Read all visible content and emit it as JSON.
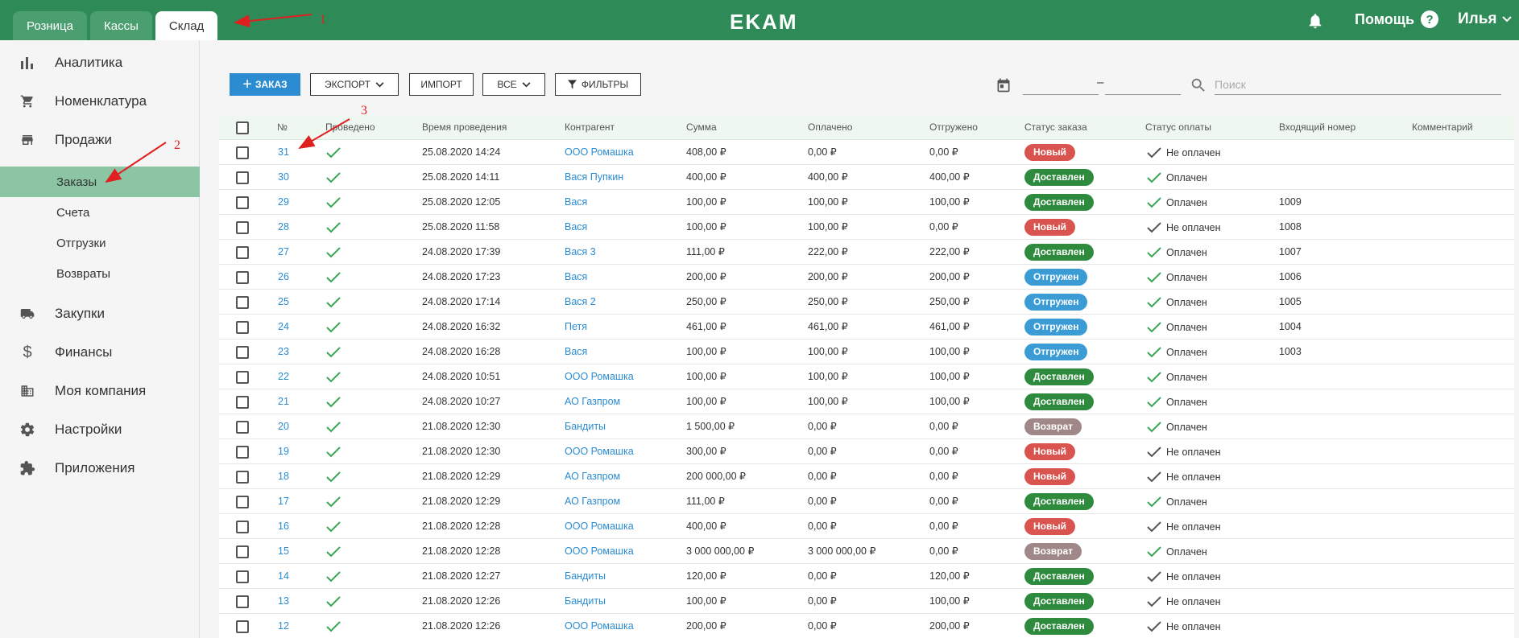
{
  "header": {
    "tabs": [
      {
        "label": "Розница"
      },
      {
        "label": "Кассы"
      },
      {
        "label": "Склад"
      }
    ],
    "active_tab": 2,
    "logo": "EKAM",
    "help_label": "Помощь",
    "help_glyph": "?",
    "user_name": "Илья",
    "icons": [
      "bell-icon",
      "help-icon",
      "chevron-down-icon"
    ]
  },
  "sidebar": {
    "items": [
      {
        "label": "Аналитика",
        "icon": "bar-chart-icon"
      },
      {
        "label": "Номенклатура",
        "icon": "cart-icon"
      },
      {
        "label": "Продажи",
        "icon": "store-icon"
      }
    ],
    "sub_items": [
      {
        "label": "Заказы",
        "active": true
      },
      {
        "label": "Счета"
      },
      {
        "label": "Отгрузки"
      },
      {
        "label": "Возвраты"
      }
    ],
    "items2": [
      {
        "label": "Закупки",
        "icon": "truck-icon"
      },
      {
        "label": "Финансы",
        "icon": "dollar-icon"
      },
      {
        "label": "Моя компания",
        "icon": "building-icon"
      },
      {
        "label": "Настройки",
        "icon": "gear-icon"
      },
      {
        "label": "Приложения",
        "icon": "puzzle-icon"
      }
    ]
  },
  "toolbar": {
    "add_label": "ЗАКАЗ",
    "add_glyph": "+",
    "export_label": "ЭКСПОРТ",
    "import_label": "ИМПОРТ",
    "all_label": "ВСЕ",
    "filters_label": "ФИЛЬТРЫ",
    "date_separator": "–",
    "search_placeholder": "Поиск"
  },
  "table": {
    "columns": [
      "№",
      "Проведено",
      "Время проведения",
      "Контрагент",
      "Сумма",
      "Оплачено",
      "Отгружено",
      "Статус заказа",
      "Статус оплаты",
      "Входящий номер",
      "Комментарий"
    ],
    "rows": [
      {
        "num": "31",
        "time": "25.08.2020 14:24",
        "party": "ООО Ромашка",
        "sum": "408,00 ₽",
        "paid": "0,00 ₽",
        "shipped": "0,00 ₽",
        "status": "Новый",
        "pay": "Не оплачен",
        "inc": ""
      },
      {
        "num": "30",
        "time": "25.08.2020 14:11",
        "party": "Вася Пупкин",
        "sum": "400,00 ₽",
        "paid": "400,00 ₽",
        "shipped": "400,00 ₽",
        "status": "Доставлен",
        "pay": "Оплачен",
        "inc": ""
      },
      {
        "num": "29",
        "time": "25.08.2020 12:05",
        "party": "Вася",
        "sum": "100,00 ₽",
        "paid": "100,00 ₽",
        "shipped": "100,00 ₽",
        "status": "Доставлен",
        "pay": "Оплачен",
        "inc": "1009"
      },
      {
        "num": "28",
        "time": "25.08.2020 11:58",
        "party": "Вася",
        "sum": "100,00 ₽",
        "paid": "100,00 ₽",
        "shipped": "0,00 ₽",
        "status": "Новый",
        "pay": "Не оплачен",
        "inc": "1008"
      },
      {
        "num": "27",
        "time": "24.08.2020 17:39",
        "party": "Вася 3",
        "sum": "111,00 ₽",
        "paid": "222,00 ₽",
        "shipped": "222,00 ₽",
        "status": "Доставлен",
        "pay": "Оплачен",
        "inc": "1007"
      },
      {
        "num": "26",
        "time": "24.08.2020 17:23",
        "party": "Вася",
        "sum": "200,00 ₽",
        "paid": "200,00 ₽",
        "shipped": "200,00 ₽",
        "status": "Отгружен",
        "pay": "Оплачен",
        "inc": "1006"
      },
      {
        "num": "25",
        "time": "24.08.2020 17:14",
        "party": "Вася 2",
        "sum": "250,00 ₽",
        "paid": "250,00 ₽",
        "shipped": "250,00 ₽",
        "status": "Отгружен",
        "pay": "Оплачен",
        "inc": "1005"
      },
      {
        "num": "24",
        "time": "24.08.2020 16:32",
        "party": "Петя",
        "sum": "461,00 ₽",
        "paid": "461,00 ₽",
        "shipped": "461,00 ₽",
        "status": "Отгружен",
        "pay": "Оплачен",
        "inc": "1004"
      },
      {
        "num": "23",
        "time": "24.08.2020 16:28",
        "party": "Вася",
        "sum": "100,00 ₽",
        "paid": "100,00 ₽",
        "shipped": "100,00 ₽",
        "status": "Отгружен",
        "pay": "Оплачен",
        "inc": "1003"
      },
      {
        "num": "22",
        "time": "24.08.2020 10:51",
        "party": "ООО Ромашка",
        "sum": "100,00 ₽",
        "paid": "100,00 ₽",
        "shipped": "100,00 ₽",
        "status": "Доставлен",
        "pay": "Оплачен",
        "inc": ""
      },
      {
        "num": "21",
        "time": "24.08.2020 10:27",
        "party": "АО Газпром",
        "sum": "100,00 ₽",
        "paid": "100,00 ₽",
        "shipped": "100,00 ₽",
        "status": "Доставлен",
        "pay": "Оплачен",
        "inc": ""
      },
      {
        "num": "20",
        "time": "21.08.2020 12:30",
        "party": "Бандиты",
        "sum": "1 500,00 ₽",
        "paid": "0,00 ₽",
        "shipped": "0,00 ₽",
        "status": "Возврат",
        "pay": "Оплачен",
        "inc": ""
      },
      {
        "num": "19",
        "time": "21.08.2020 12:30",
        "party": "ООО Ромашка",
        "sum": "300,00 ₽",
        "paid": "0,00 ₽",
        "shipped": "0,00 ₽",
        "status": "Новый",
        "pay": "Не оплачен",
        "inc": ""
      },
      {
        "num": "18",
        "time": "21.08.2020 12:29",
        "party": "АО Газпром",
        "sum": "200 000,00 ₽",
        "paid": "0,00 ₽",
        "shipped": "0,00 ₽",
        "status": "Новый",
        "pay": "Не оплачен",
        "inc": ""
      },
      {
        "num": "17",
        "time": "21.08.2020 12:29",
        "party": "АО Газпром",
        "sum": "111,00 ₽",
        "paid": "0,00 ₽",
        "shipped": "0,00 ₽",
        "status": "Доставлен",
        "pay": "Оплачен",
        "inc": ""
      },
      {
        "num": "16",
        "time": "21.08.2020 12:28",
        "party": "ООО Ромашка",
        "sum": "400,00 ₽",
        "paid": "0,00 ₽",
        "shipped": "0,00 ₽",
        "status": "Новый",
        "pay": "Не оплачен",
        "inc": ""
      },
      {
        "num": "15",
        "time": "21.08.2020 12:28",
        "party": "ООО Ромашка",
        "sum": "3 000 000,00 ₽",
        "paid": "3 000 000,00 ₽",
        "shipped": "0,00 ₽",
        "status": "Возврат",
        "pay": "Оплачен",
        "inc": ""
      },
      {
        "num": "14",
        "time": "21.08.2020 12:27",
        "party": "Бандиты",
        "sum": "120,00 ₽",
        "paid": "0,00 ₽",
        "shipped": "120,00 ₽",
        "status": "Доставлен",
        "pay": "Не оплачен",
        "inc": ""
      },
      {
        "num": "13",
        "time": "21.08.2020 12:26",
        "party": "Бандиты",
        "sum": "100,00 ₽",
        "paid": "0,00 ₽",
        "shipped": "100,00 ₽",
        "status": "Доставлен",
        "pay": "Не оплачен",
        "inc": ""
      },
      {
        "num": "12",
        "time": "21.08.2020 12:26",
        "party": "ООО Ромашка",
        "sum": "200,00 ₽",
        "paid": "0,00 ₽",
        "shipped": "200,00 ₽",
        "status": "Доставлен",
        "pay": "Не оплачен",
        "inc": ""
      }
    ]
  },
  "status_colors": {
    "Новый": "#d9534f",
    "Доставлен": "#2e8b3e",
    "Отгружен": "#3a9bd5",
    "Возврат": "#a08888"
  },
  "pay_colors": {
    "Оплачен": "#3aa655",
    "Не оплачен": "#555555"
  },
  "colors": {
    "brand": "#2e8b57",
    "accent": "#2b8cd1",
    "active_sub": "#8cc5a3",
    "annotation": "#e02020"
  },
  "annotations": [
    "1",
    "2",
    "3"
  ]
}
